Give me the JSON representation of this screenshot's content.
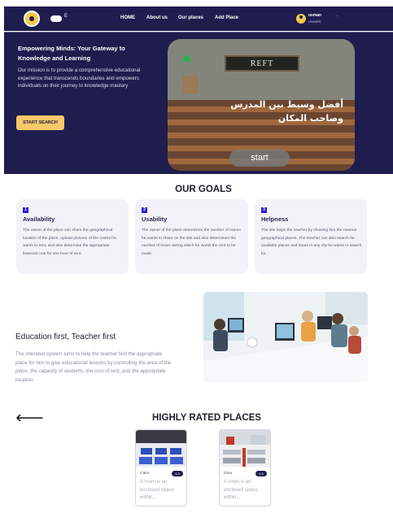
{
  "nav": {
    "lang_toggle_label": "E",
    "links": [
      "HOME",
      "About us",
      "Our places",
      "Add Place"
    ],
    "user_name": "osman",
    "user_role": "OWNER",
    "chevron": "."
  },
  "hero": {
    "title": "Empowering Minds: Your Gateway to Knowledge and Learning",
    "description": "Our mission is to provide a comprehensive educational experience that transcends boundaries and empowers individuals on their journey to knowledge mastery",
    "cta_label": "START SEARCH",
    "image": {
      "board_text": "REFT",
      "arabic_line1": "أفضل وسيط بين المدرس",
      "arabic_line2": "وصاحب المكان",
      "start_label": "start"
    }
  },
  "goals": {
    "title": "OUR GOALS",
    "items": [
      {
        "number": "1",
        "title": "Availability",
        "text": "The owner of the place can share the geographical location of the place, upload pictures of the rooms he wants to rent, and also determine the appropriate financial cost for one hour of rent."
      },
      {
        "number": "2",
        "title": "Usability",
        "text": "The owner of the place determines the number of rooms he wants to share on the site and also determines the number of hours during which he wants the rent to be made."
      },
      {
        "number": "3",
        "title": "Helpness",
        "text": "The site helps the teacher by showing him the nearest geographical places. The teacher can also search for available places and hours in any city he wants to search for."
      }
    ]
  },
  "education": {
    "title": "Education first, Teacher first",
    "text": "The intended system aims to help the teacher find the appropriate place for him to give educational lessons by controlling the area of the place, the capacity of students, the cost of rent, and the appropriate location"
  },
  "rated": {
    "title": "HIGHLY RATED PLACES",
    "back_arrow": "🡐",
    "places": [
      {
        "city": "Cairo",
        "badge": "4.6",
        "description": "A room is an enclosed space within..."
      },
      {
        "city": "Giza",
        "badge": "4.4",
        "description": "A room is an enclosed space within..."
      }
    ]
  },
  "colors": {
    "navy": "#1f1d4e",
    "accent_yellow": "#f7c96a",
    "goal_number_blue": "#2a1fd4"
  }
}
